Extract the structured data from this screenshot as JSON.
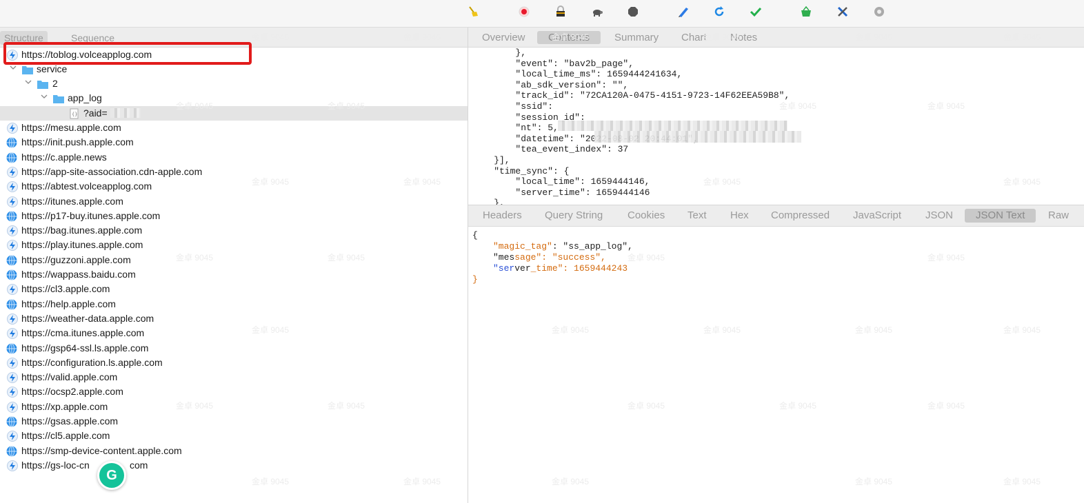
{
  "left_tabs": [
    "Structure",
    "Sequence"
  ],
  "tree": {
    "root": "https://toblog.volceapplog.com",
    "service": "service",
    "num": "2",
    "app_log": "app_log",
    "aid": "?aid=",
    "hosts": [
      "https://mesu.apple.com",
      "https://init.push.apple.com",
      "https://c.apple.news",
      "https://app-site-association.cdn-apple.com",
      "https://abtest.volceapplog.com",
      "https://itunes.apple.com",
      "https://p17-buy.itunes.apple.com",
      "https://bag.itunes.apple.com",
      "https://play.itunes.apple.com",
      "https://guzzoni.apple.com",
      "https://wappass.baidu.com",
      "https://cl3.apple.com",
      "https://help.apple.com",
      "https://weather-data.apple.com",
      "https://cma.itunes.apple.com",
      "https://gsp64-ssl.ls.apple.com",
      "https://configuration.ls.apple.com",
      "https://valid.apple.com",
      "https://ocsp2.apple.com",
      "https://xp.apple.com",
      "https://gsas.apple.com",
      "https://cl5.apple.com",
      "https://smp-device-content.apple.com",
      "https://gs-loc-cn"
    ],
    "host_icons": [
      "bolt",
      "globe",
      "globe",
      "bolt",
      "bolt",
      "bolt",
      "globe",
      "bolt",
      "bolt",
      "globe",
      "globe",
      "bolt",
      "globe",
      "bolt",
      "bolt",
      "globe",
      "bolt",
      "bolt",
      "bolt",
      "bolt",
      "globe",
      "bolt",
      "globe",
      "bolt"
    ],
    "last_tail": "com"
  },
  "right_tabs": [
    "Overview",
    "Contents",
    "Summary",
    "Chart",
    "Notes"
  ],
  "request_lines": [
    "        },",
    "        \"event\": \"bav2b_page\",",
    "        \"local_time_ms\": 1659444241634,",
    "        \"ab_sdk_version\": \"\",",
    "        \"track_id\": \"72CA120A-0475-4151-9723-14F62EEA59B8\",",
    "        \"ssid\":",
    "        \"session_id\":",
    "        \"nt\": 5,",
    "        \"datetime\": \"2022-08-02 20:44:01\",",
    "        \"tea_event_index\": 37",
    "    }],",
    "    \"time_sync\": {",
    "        \"local_time\": 1659444146,",
    "        \"server_time\": 1659444146",
    "    },"
  ],
  "bottom_tabs": [
    "Headers",
    "Query String",
    "Cookies",
    "Text",
    "Hex",
    "Compressed",
    "JavaScript",
    "JSON",
    "JSON Text",
    "Raw"
  ],
  "response": {
    "open": "{",
    "l1_key": "\"magic_tag\"",
    "l1_rest": ": \"s",
    "l1_val": "s_app_log\",",
    "l2_a": "\"mes",
    "l2_b": "sage\": \"success\",",
    "l3_a": "\"ser",
    "l3_b": "ver",
    "l3_c": "_time\": 1659444243",
    "close": "}"
  },
  "watermark": "金卓 9045",
  "grammarly": "G"
}
